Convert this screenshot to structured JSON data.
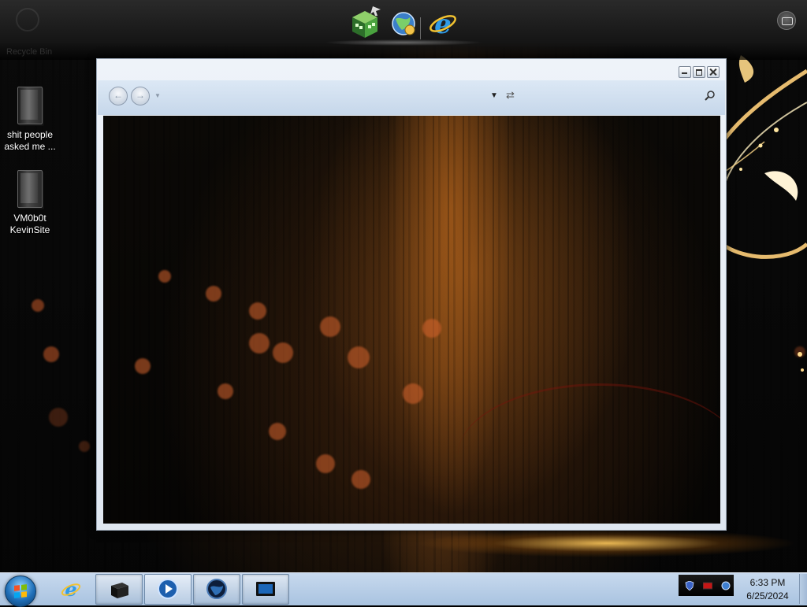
{
  "top_bar": {
    "ghost_label": "Recycle Bin",
    "dock_items": [
      {
        "name": "cube-app-icon"
      },
      {
        "name": "globe-network-icon"
      },
      {
        "name": "internet-explorer-icon"
      }
    ]
  },
  "desktop": {
    "icons": [
      {
        "line1": "shit people",
        "line2": "asked me ..."
      },
      {
        "line1": "VM0b0t",
        "line2": "KevinSite"
      }
    ]
  },
  "explorer_window": {
    "controls": [
      "minimize",
      "maximize",
      "close"
    ]
  },
  "taskbar": {
    "pinned": [
      {
        "name": "internet-explorer-icon"
      },
      {
        "name": "black-box-app-icon"
      },
      {
        "name": "media-player-icon"
      },
      {
        "name": "globe-icon"
      },
      {
        "name": "monitor-icon"
      }
    ],
    "clock": {
      "time": "6:33 PM",
      "date": "6/25/2024"
    }
  },
  "colors": {
    "taskbar": "#b8cce3",
    "window_chrome": "#dce8f5",
    "wallpaper_accent": "#c8782a"
  }
}
